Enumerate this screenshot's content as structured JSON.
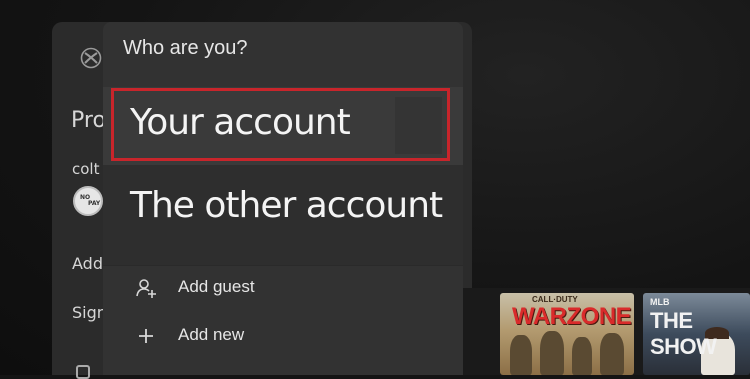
{
  "menu": {
    "title": "Who are you?",
    "accounts": [
      {
        "label": "Your account",
        "highlighted": true
      },
      {
        "label": "The other account",
        "highlighted": false
      }
    ],
    "actions": [
      {
        "label": "Add guest",
        "icon": "add-person-icon"
      },
      {
        "label": "Add new",
        "icon": "plus-icon"
      }
    ]
  },
  "guide": {
    "heading": "Pro",
    "user_name": "colt",
    "add_text": "Add",
    "sign_text": "Sign",
    "logo": "xbox-logo-icon"
  },
  "tiles": [
    {
      "sub": "CALL·DUTY",
      "title": "WARZONE"
    },
    {
      "sub": "MLB",
      "title": "THE SHOW"
    }
  ],
  "colors": {
    "highlight": "#c8252b",
    "menu_bg": "#323232",
    "background": "#141414"
  }
}
